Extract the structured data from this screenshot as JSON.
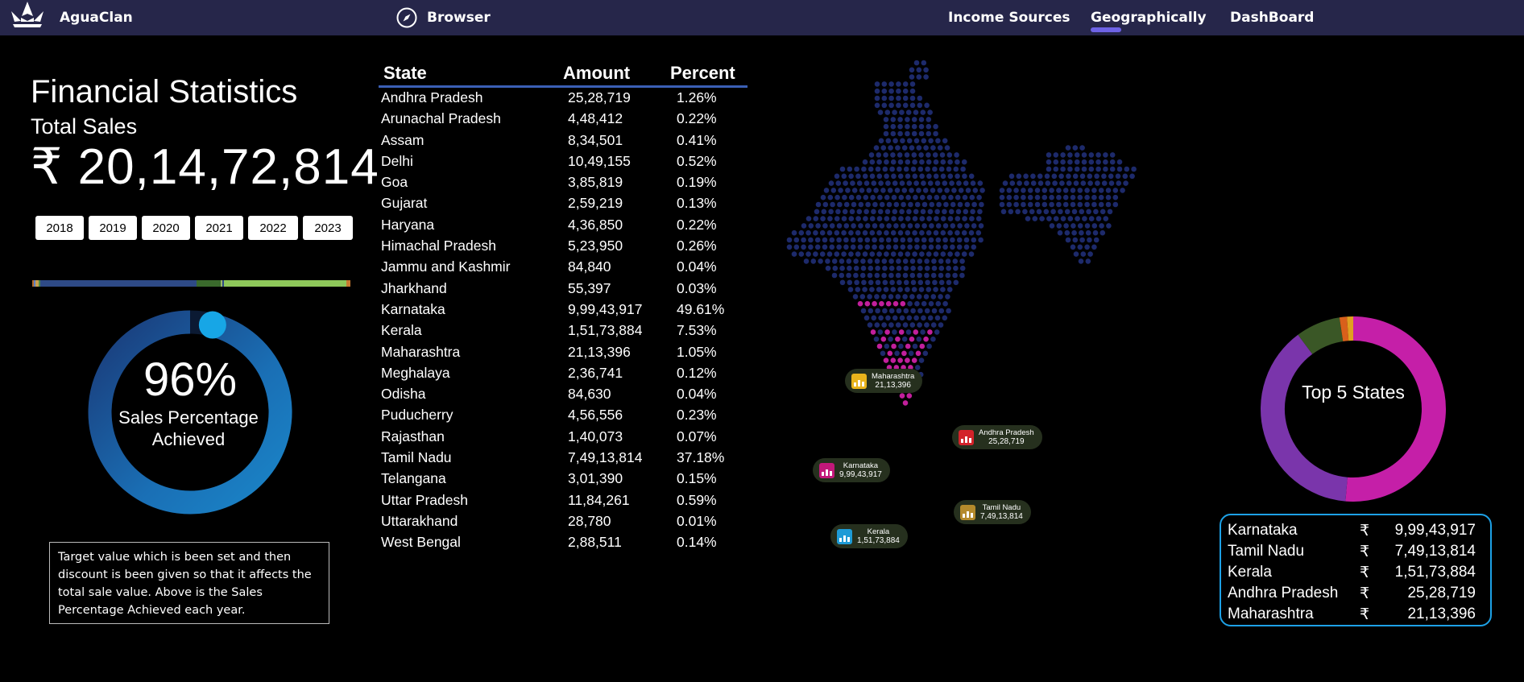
{
  "topbar": {
    "brand": "AguaClan",
    "browser_label": "Browser",
    "nav": [
      "Income Sources",
      "Geographically",
      "DashBoard"
    ],
    "active_nav": "Geographically"
  },
  "summary": {
    "title": "Financial Statistics",
    "subtitle": "Total Sales",
    "total": "₹ 20,14,72,814",
    "years": [
      "2018",
      "2019",
      "2020",
      "2021",
      "2022",
      "2023"
    ],
    "gauge_percent": 96,
    "gauge_value": "96%",
    "gauge_label": "Sales Percentage Achieved",
    "note": "Target value which is been set and then discount is been given so that it affects the total sale value. Above is the Sales Percentage Achieved each year."
  },
  "table": {
    "headers": [
      "State",
      "Amount",
      "Percent"
    ],
    "rows": [
      [
        "Andhra Pradesh",
        "25,28,719",
        "1.26%"
      ],
      [
        "Arunachal Pradesh",
        "4,48,412",
        "0.22%"
      ],
      [
        "Assam",
        "8,34,501",
        "0.41%"
      ],
      [
        "Delhi",
        "10,49,155",
        "0.52%"
      ],
      [
        "Goa",
        "3,85,819",
        "0.19%"
      ],
      [
        "Gujarat",
        "2,59,219",
        "0.13%"
      ],
      [
        "Haryana",
        "4,36,850",
        "0.22%"
      ],
      [
        "Himachal Pradesh",
        "5,23,950",
        "0.26%"
      ],
      [
        "Jammu and Kashmir",
        "84,840",
        "0.04%"
      ],
      [
        "Jharkhand",
        "55,397",
        "0.03%"
      ],
      [
        "Karnataka",
        "9,99,43,917",
        "49.61%"
      ],
      [
        "Kerala",
        "1,51,73,884",
        "7.53%"
      ],
      [
        "Maharashtra",
        "21,13,396",
        "1.05%"
      ],
      [
        "Meghalaya",
        "2,36,741",
        "0.12%"
      ],
      [
        "Odisha",
        "84,630",
        "0.04%"
      ],
      [
        "Puducherry",
        "4,56,556",
        "0.23%"
      ],
      [
        "Rajasthan",
        "1,40,073",
        "0.07%"
      ],
      [
        "Tamil Nadu",
        "7,49,13,814",
        "37.18%"
      ],
      [
        "Telangana",
        "3,01,390",
        "0.15%"
      ],
      [
        "Uttar Pradesh",
        "11,84,261",
        "0.59%"
      ],
      [
        "Uttarakhand",
        "28,780",
        "0.01%"
      ],
      [
        "West Bengal",
        "2,88,511",
        "0.14%"
      ]
    ]
  },
  "map_callouts": [
    {
      "state": "Maharashtra",
      "value": "21,13,396",
      "icon_color": "#e8b31c"
    },
    {
      "state": "Andhra Pradesh",
      "value": "25,28,719",
      "icon_color": "#d3232a"
    },
    {
      "state": "Karnataka",
      "value": "9,99,43,917",
      "icon_color": "#c2187a"
    },
    {
      "state": "Tamil Nadu",
      "value": "7,49,13,814",
      "icon_color": "#b48a2c"
    },
    {
      "state": "Kerala",
      "value": "1,51,73,884",
      "icon_color": "#1e9bd6"
    }
  ],
  "top5": {
    "label": "Top 5 States",
    "currency": "₹",
    "rows": [
      {
        "state": "Karnataka",
        "amount": "9,99,43,917"
      },
      {
        "state": "Tamil Nadu",
        "amount": "7,49,13,814"
      },
      {
        "state": "Kerala",
        "amount": "1,51,73,884"
      },
      {
        "state": "Andhra Pradesh",
        "amount": "25,28,719"
      },
      {
        "state": "Maharashtra",
        "amount": "21,13,396"
      }
    ],
    "donut_values": [
      99943917,
      74913814,
      15173884,
      2528719,
      2113396
    ],
    "donut_colors": [
      "#c51fa8",
      "#7a35ab",
      "#3a5726",
      "#d8601b",
      "#e0a020"
    ]
  },
  "colors": {
    "topbar": "#26264a",
    "accent": "#6e63e6",
    "map_dot": "#1d2a6b",
    "map_highlight": "#c21f9c",
    "gauge": "#1a7fc1"
  }
}
